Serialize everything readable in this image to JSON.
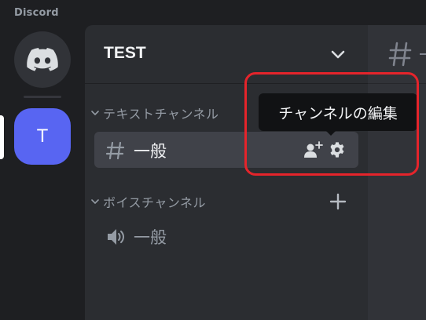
{
  "app": {
    "brand": "Discord"
  },
  "server": {
    "icon_letter": "T",
    "name": "TEST"
  },
  "categories": {
    "text": {
      "label": "テキストチャンネル"
    },
    "voice": {
      "label": "ボイスチャンネル"
    }
  },
  "channels": {
    "text": [
      {
        "name": "一般",
        "icon": "hash-icon"
      }
    ],
    "voice": [
      {
        "name": "一般",
        "icon": "speaker-icon"
      }
    ]
  },
  "tooltip": {
    "text": "チャンネルの編集"
  },
  "colors": {
    "accent": "#5865f2",
    "highlight": "#e5242b",
    "rail_bg": "#1e1f22",
    "panel_bg": "#2b2d31",
    "selected_bg": "#404249",
    "chat_bg": "#313338"
  }
}
